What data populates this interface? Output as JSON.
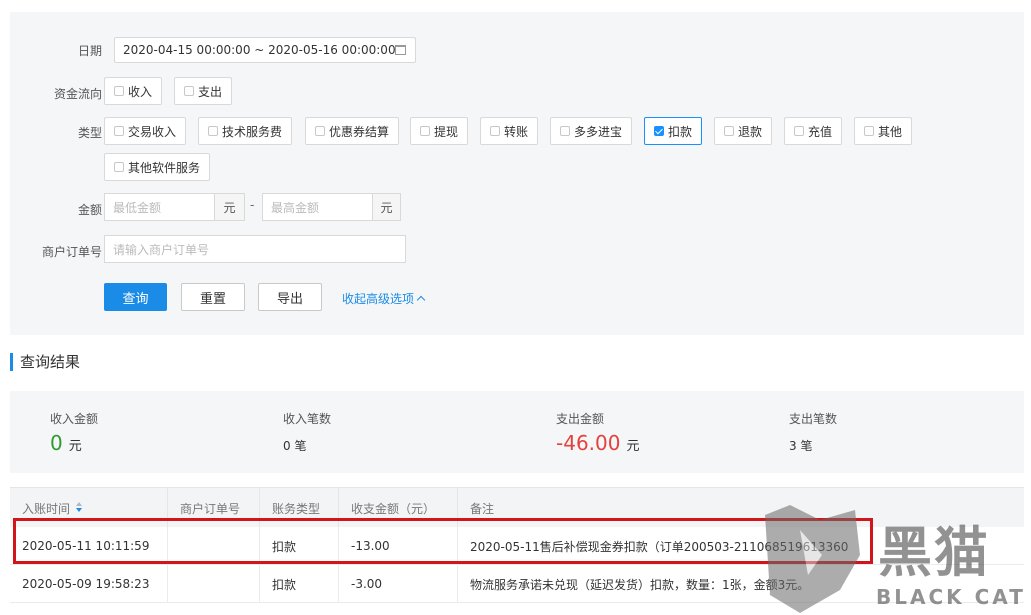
{
  "filters": {
    "date_label": "日期",
    "date_range": "2020-04-15 00:00:00 ~ 2020-05-16 00:00:00",
    "flow_label": "资金流向",
    "flow_options": [
      {
        "label": "收入",
        "checked": false
      },
      {
        "label": "支出",
        "checked": false
      }
    ],
    "type_label": "类型",
    "type_options": [
      {
        "label": "交易收入",
        "checked": false
      },
      {
        "label": "技术服务费",
        "checked": false
      },
      {
        "label": "优惠券结算",
        "checked": false
      },
      {
        "label": "提现",
        "checked": false
      },
      {
        "label": "转账",
        "checked": false
      },
      {
        "label": "多多进宝",
        "checked": false
      },
      {
        "label": "扣款",
        "checked": true
      },
      {
        "label": "退款",
        "checked": false
      },
      {
        "label": "充值",
        "checked": false
      },
      {
        "label": "其他",
        "checked": false
      },
      {
        "label": "其他软件服务",
        "checked": false
      }
    ],
    "amount_label": "金额",
    "amount_min_placeholder": "最低金额",
    "amount_max_placeholder": "最高金额",
    "amount_unit": "元",
    "amount_sep": "-",
    "order_label": "商户订单号",
    "order_placeholder": "请输入商户订单号",
    "query_button": "查询",
    "reset_button": "重置",
    "export_button": "导出",
    "collapse_link": "收起高级选项"
  },
  "results": {
    "title": "查询结果",
    "income_amount_label": "收入金额",
    "income_amount": "0",
    "income_amount_unit": "元",
    "income_count_label": "收入笔数",
    "income_count": "0 笔",
    "expense_amount_label": "支出金额",
    "expense_amount": "-46.00",
    "expense_amount_unit": "元",
    "expense_count_label": "支出笔数",
    "expense_count": "3 笔"
  },
  "table": {
    "headers": [
      "入账时间",
      "商户订单号",
      "账务类型",
      "收支金额（元）",
      "备注"
    ],
    "rows": [
      {
        "time": "2020-05-11 10:11:59",
        "order": "",
        "type": "扣款",
        "amount": "-13.00",
        "note": "2020-05-11售后补偿现金券扣款（订单200503-211068519613360"
      },
      {
        "time": "2020-05-09 19:58:23",
        "order": "",
        "type": "扣款",
        "amount": "-3.00",
        "note": "物流服务承诺未兑现（延迟发货）扣款，数量：1张，金额3元。"
      }
    ]
  },
  "watermark": {
    "cn": "黑猫",
    "en": "BLACK CAT"
  },
  "colors": {
    "primary": "#1a8be6",
    "income": "#2e9b2e",
    "expense": "#e5413d",
    "highlight": "#d0161b"
  }
}
